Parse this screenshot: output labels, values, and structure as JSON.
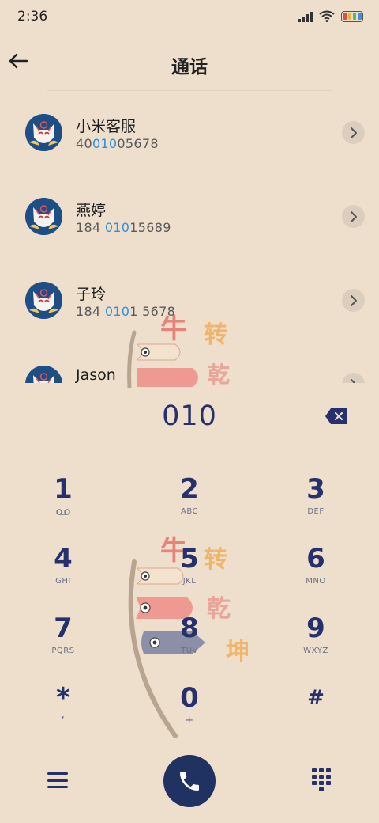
{
  "status_bar": {
    "time": "2:36",
    "icons": [
      "signal-icon",
      "wifi-icon",
      "battery-icon"
    ]
  },
  "header": {
    "title": "通话",
    "back_icon": "back-arrow-icon"
  },
  "contacts": [
    {
      "name": "小米客服",
      "number_pre": "40",
      "number_match": "010",
      "number_post": "05678"
    },
    {
      "name": "燕婷",
      "number_pre": "184 ",
      "number_match": "010",
      "number_post": "15689"
    },
    {
      "name": "子玲",
      "number_pre": "184 ",
      "number_match": "010",
      "number_post": "1 5678"
    },
    {
      "name": "Jason",
      "number_pre": "",
      "number_match": "",
      "number_post": ""
    }
  ],
  "dialer": {
    "input": "010",
    "backspace_icon": "backspace-icon"
  },
  "keypad": [
    {
      "digit": "1",
      "sub": ""
    },
    {
      "digit": "2",
      "sub": "ABC"
    },
    {
      "digit": "3",
      "sub": "DEF"
    },
    {
      "digit": "4",
      "sub": "GHI"
    },
    {
      "digit": "5",
      "sub": "JKL"
    },
    {
      "digit": "6",
      "sub": "MNO"
    },
    {
      "digit": "7",
      "sub": "PQRS"
    },
    {
      "digit": "8",
      "sub": "TUV"
    },
    {
      "digit": "9",
      "sub": "WXYZ"
    },
    {
      "digit": "*",
      "sub": ","
    },
    {
      "digit": "0",
      "sub": "+"
    },
    {
      "digit": "#",
      "sub": ""
    }
  ],
  "bottom_bar": {
    "menu_icon": "menu-icon",
    "call_icon": "phone-icon",
    "keypad_icon": "dialpad-icon"
  },
  "decoration": {
    "text": [
      "牛",
      "转",
      "乾",
      "坤"
    ]
  },
  "colors": {
    "background": "#EEDFCC",
    "accent": "#26306A",
    "call_button": "#1F3262",
    "match_highlight": "#2E8FDC"
  }
}
